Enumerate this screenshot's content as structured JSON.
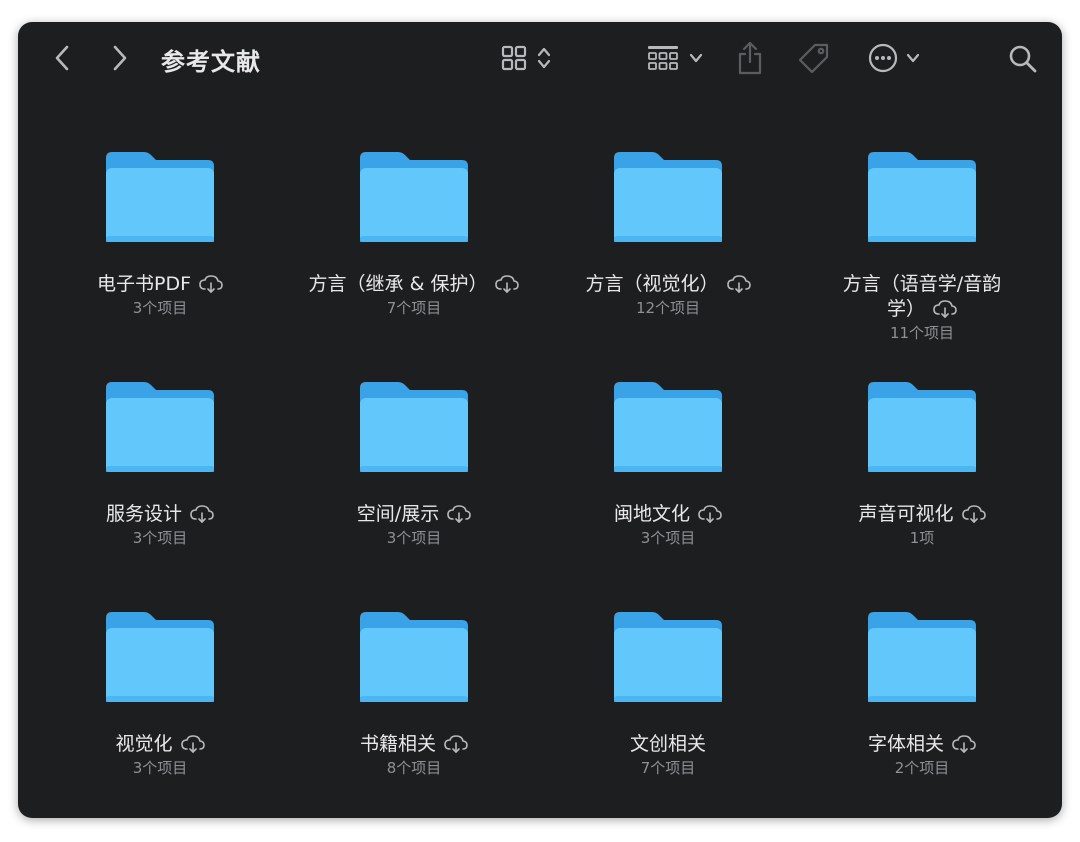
{
  "window": {
    "title": "参考文献"
  },
  "toolbar": {
    "icons": [
      "back-chevron-icon",
      "forward-chevron-icon",
      "grid-view-icon",
      "sort-updown-icon",
      "group-icon",
      "chevron-down-icon",
      "share-icon",
      "tag-icon",
      "more-icon",
      "search-icon"
    ]
  },
  "folders": [
    {
      "name": "电子书PDF",
      "count": "3个项目"
    },
    {
      "name": "方言（继承 & 保护）",
      "count": "7个项目"
    },
    {
      "name": "方言（视觉化）",
      "count": "12个项目"
    },
    {
      "name": "方言（语音学/音韵学）",
      "count": "11个项目"
    },
    {
      "name": "服务设计",
      "count": "3个项目"
    },
    {
      "name": "空间/展示",
      "count": "3个项目"
    },
    {
      "name": "闽地文化",
      "count": "3个项目"
    },
    {
      "name": "声音可视化",
      "count": "1项"
    },
    {
      "name": "视觉化",
      "count": "3个项目"
    },
    {
      "name": "书籍相关",
      "count": "8个项目"
    },
    {
      "name": "文创相关",
      "count": "7个项目"
    },
    {
      "name": "字体相关",
      "count": "2个项目"
    }
  ],
  "colors": {
    "window_bg": "#1d1e20",
    "folder_front": "#62c8fc",
    "folder_back": "#3aa3e8",
    "text_primary": "#e8e8ea",
    "text_secondary": "#8f9094",
    "icon": "#b8b9bc",
    "icon_disabled": "#5c5d60"
  }
}
